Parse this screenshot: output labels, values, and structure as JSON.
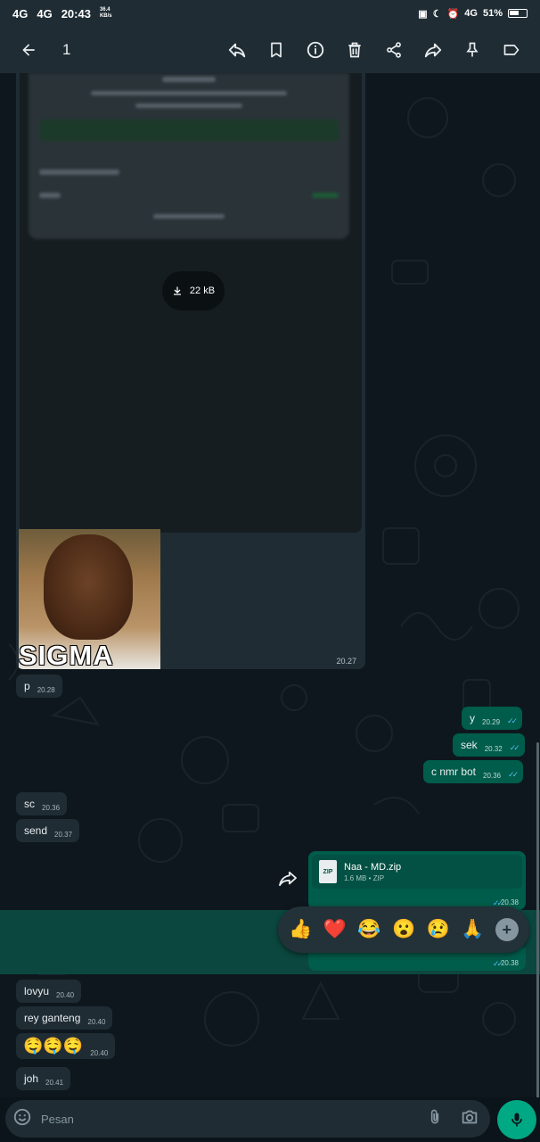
{
  "status_bar": {
    "network1": "4G",
    "network2": "4G",
    "time": "20:43",
    "speed": "36.4 KB/s",
    "signal": "4G",
    "battery": "51%"
  },
  "action_bar": {
    "selected_count": "1",
    "icons": [
      "back-arrow-icon",
      "reply-icon",
      "bookmark-icon",
      "info-icon",
      "delete-icon",
      "share-icon",
      "forward-icon",
      "pin-icon",
      "label-icon"
    ]
  },
  "image_message": {
    "download_size": "22 kB",
    "sticker_text": "SIGMA",
    "time": "20.27"
  },
  "messages": [
    {
      "dir": "in",
      "text": "p",
      "time": "20.28"
    },
    {
      "dir": "out",
      "text": "y",
      "time": "20.29"
    },
    {
      "dir": "out",
      "text": "sek",
      "time": "20.32"
    },
    {
      "dir": "out",
      "text": "c nmr bot",
      "time": "20.36"
    },
    {
      "dir": "in",
      "text": "sc",
      "time": "20.36"
    },
    {
      "dir": "in",
      "text": "send",
      "time": "20.37"
    },
    {
      "dir": "in",
      "text": "lovyu",
      "time": "20.40"
    },
    {
      "dir": "in",
      "text": "rey ganteng",
      "time": "20.40"
    },
    {
      "dir": "in",
      "text": "🤤🤤🤤",
      "time": "20.40"
    },
    {
      "dir": "in",
      "text": "joh",
      "time": "20.41"
    }
  ],
  "file_message": {
    "name": "Naa - MD.zip",
    "meta": "1.6 MB • ZIP",
    "icon_label": "ZIP",
    "time": "20.38"
  },
  "selected_message": {
    "time": "20.38"
  },
  "reactions": [
    "👍",
    "❤️",
    "😂",
    "😮",
    "😢",
    "🙏"
  ],
  "input": {
    "placeholder": "Pesan"
  },
  "colors": {
    "header": "#1f2c34",
    "outgoing_bubble": "#005c4b",
    "incoming_bubble": "#1f2c34",
    "accent": "#00a884",
    "read_ticks": "#53bdeb"
  }
}
